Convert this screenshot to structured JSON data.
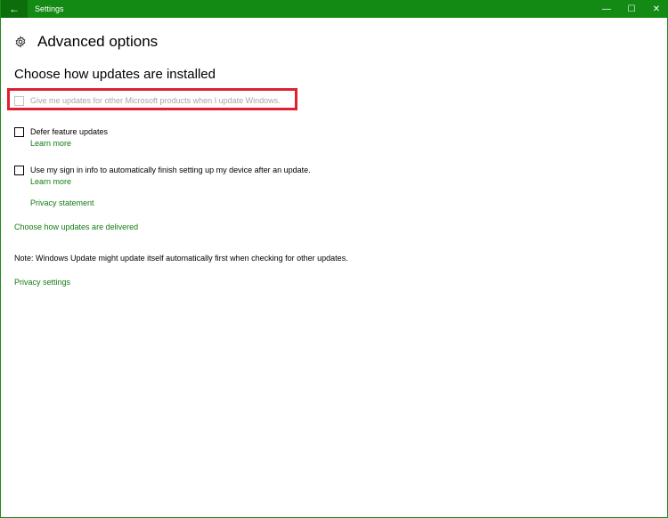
{
  "titlebar": {
    "app_title": "Settings",
    "back_glyph": "←",
    "minimize_glyph": "—",
    "maximize_glyph": "☐",
    "close_glyph": "✕"
  },
  "page": {
    "title": "Advanced options",
    "section_title": "Choose how updates are installed"
  },
  "options": [
    {
      "label": "Give me updates for other Microsoft products when I update Windows.",
      "checked": false,
      "disabled": true
    },
    {
      "label": "Defer feature updates",
      "checked": false,
      "disabled": false,
      "link": "Learn more"
    },
    {
      "label": "Use my sign in info to automatically finish setting up my device after an update.",
      "checked": false,
      "disabled": false,
      "link": "Learn more",
      "link2": "Privacy statement"
    }
  ],
  "links": {
    "delivery": "Choose how updates are delivered",
    "privacy_settings": "Privacy settings"
  },
  "note": "Note: Windows Update might update itself automatically first when checking for other updates.",
  "colors": {
    "accent": "#107c10",
    "titlebar": "#138a13",
    "highlight": "#e0202e"
  }
}
